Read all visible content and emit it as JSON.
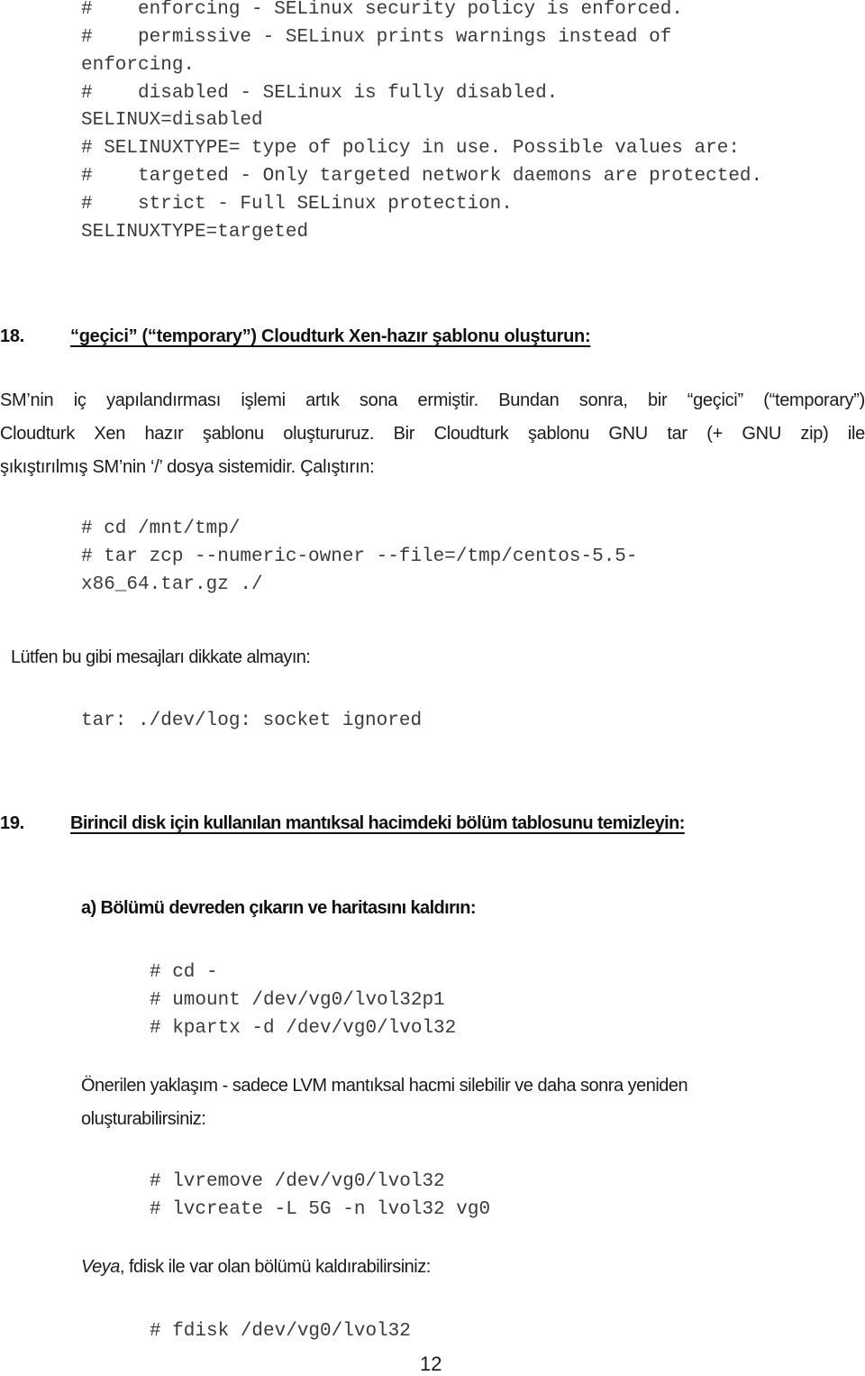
{
  "config_block": [
    "#    enforcing - SELinux security policy is enforced.",
    "#    permissive - SELinux prints warnings instead of",
    "enforcing.",
    "#    disabled - SELinux is fully disabled.",
    "SELINUX=disabled",
    "# SELINUXTYPE= type of policy in use. Possible values are:",
    "#    targeted - Only targeted network daemons are protected.",
    "#    strict - Full SELinux protection.",
    "SELINUXTYPE=targeted"
  ],
  "section18": {
    "number": "18.",
    "title": "“geçici” (“temporary”) Cloudturk Xen-hazır şablonu oluşturun:",
    "paragraph_lines": [
      "SM’nin iç yapılandırması işlemi artık sona ermiştir. Bundan sonra, bir “geçici” (“temporary”)",
      "Cloudturk Xen hazır şablonu oluştururuz. Bir Cloudturk şablonu GNU tar (+ GNU zip) ile",
      "şıkıştırılmış SM’nin ‘/’ dosya sistemidir. Çalıştırın:"
    ],
    "commands": [
      "# cd /mnt/tmp/",
      "# tar zcp --numeric-owner --file=/tmp/centos-5.5-",
      "x86_64.tar.gz ./"
    ],
    "note": "Lütfen bu gibi mesajları dikkate almayın:",
    "message": "tar: ./dev/log: socket ignored"
  },
  "section19": {
    "number": "19.",
    "title": "Birincil disk için kullanılan mantıksal hacimdeki bölüm tablosunu temizleyin:",
    "step_a": "a) Bölümü devreden çıkarın ve haritasını kaldırın:",
    "commands_a": [
      "# cd -",
      "# umount /dev/vg0/lvol32p1",
      "# kpartx -d /dev/vg0/lvol32"
    ],
    "recommended_lines": [
      "Önerilen yaklaşım - sadece LVM mantıksal hacmi silebilir ve daha sonra yeniden",
      "oluşturabilirsiniz:"
    ],
    "commands_lvm": [
      "# lvremove /dev/vg0/lvol32",
      "# lvcreate -L 5G -n lvol32 vg0"
    ],
    "alt_italic": "Veya",
    "alt_rest": ", fdisk ile var olan bölümü kaldırabilirsiniz:",
    "commands_fdisk": [
      "# fdisk /dev/vg0/lvol32"
    ]
  },
  "page_number": "12"
}
